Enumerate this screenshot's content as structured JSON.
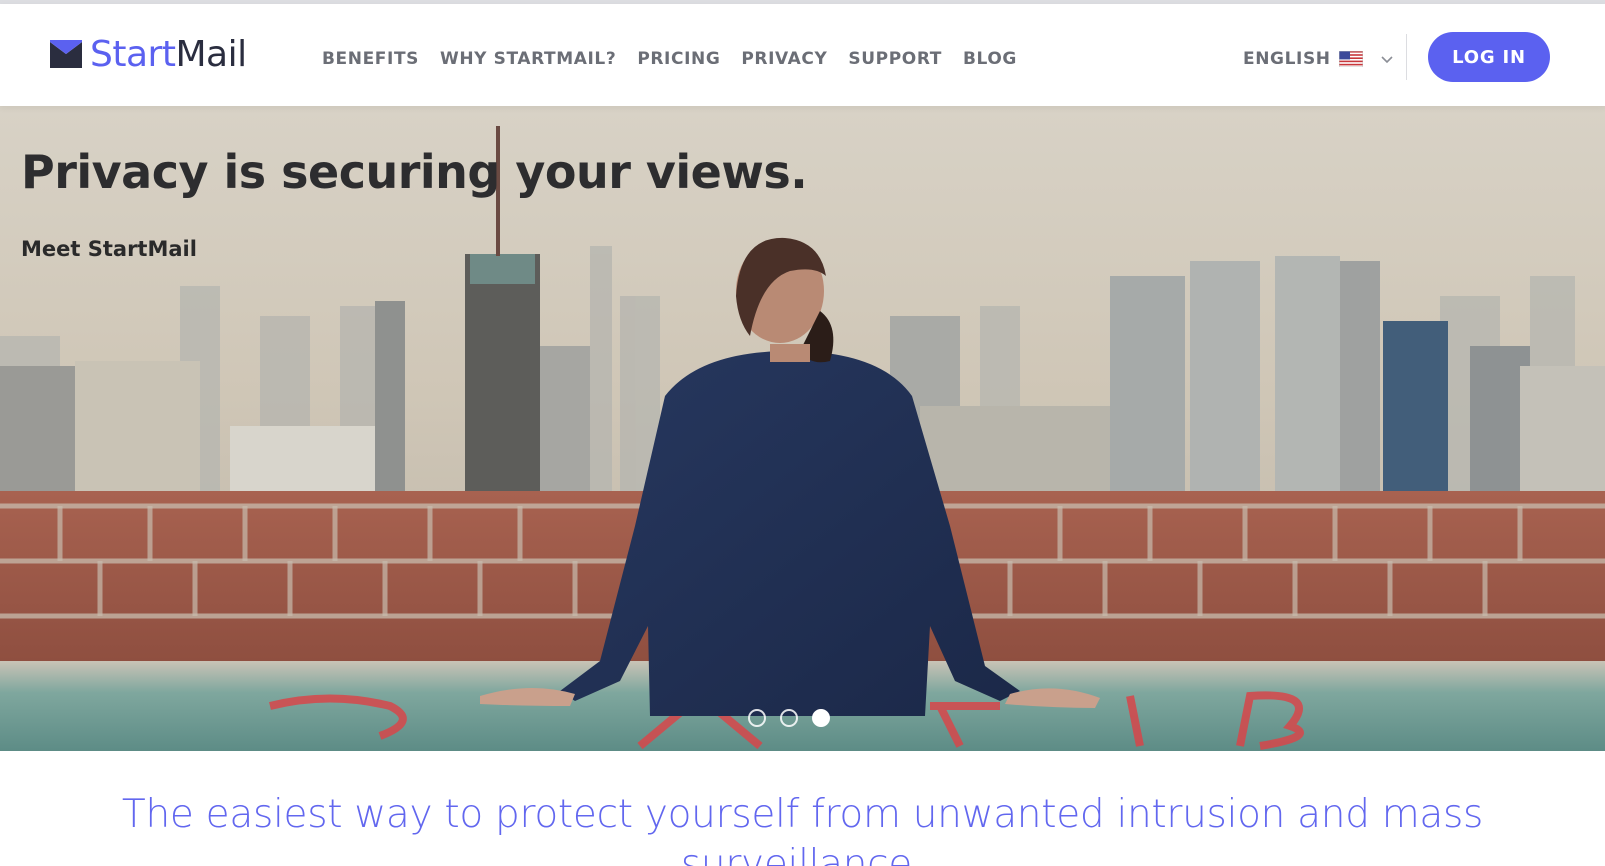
{
  "brand": {
    "name_part1": "Start",
    "name_part2": "Mail",
    "accent": "#5b61f0",
    "icon": "envelope-icon"
  },
  "nav": {
    "items": [
      "BENEFITS",
      "WHY STARTMAIL?",
      "PRICING",
      "PRIVACY",
      "SUPPORT",
      "BLOG"
    ]
  },
  "language": {
    "label": "ENGLISH",
    "flag": "us-flag-icon",
    "chevron": "chevron-down-icon"
  },
  "login": {
    "label": "LOG IN"
  },
  "hero": {
    "title": "Privacy is securing your views.",
    "subtitle": "Meet StartMail",
    "image": "man-on-rooftop-city-view",
    "slides": 3,
    "active_slide": 3
  },
  "tagline": "The easiest way to protect yourself from unwanted intrusion and mass surveillance.",
  "colors": {
    "nav_text": "#6b6e76",
    "tagline": "#6267ef",
    "login_bg": "#5b61f0"
  }
}
